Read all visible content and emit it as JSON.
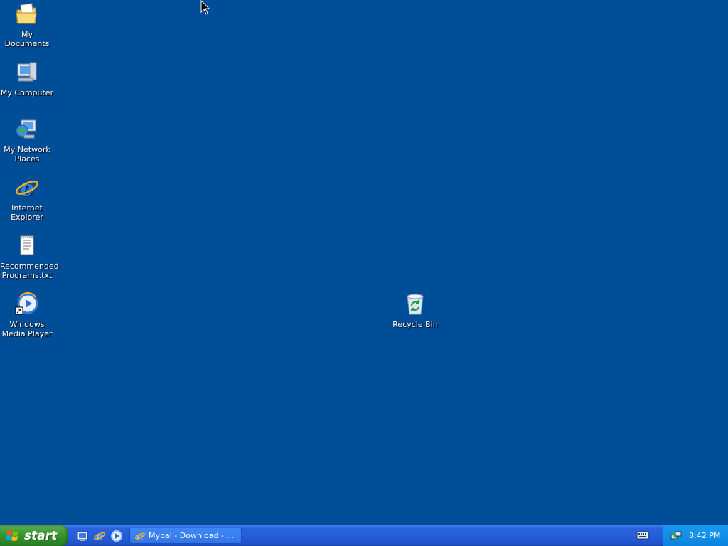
{
  "desktop": {
    "icons": [
      {
        "label": "My Documents",
        "icon": "my-documents-icon"
      },
      {
        "label": "My Computer",
        "icon": "my-computer-icon"
      },
      {
        "label": "My Network Places",
        "icon": "network-places-icon"
      },
      {
        "label": "Internet Explorer",
        "icon": "internet-explorer-icon"
      },
      {
        "label": "Recommended Programs.txt",
        "icon": "text-file-icon"
      },
      {
        "label": "Windows Media Player",
        "icon": "media-player-icon"
      },
      {
        "label": "Recycle Bin",
        "icon": "recycle-bin-icon"
      }
    ],
    "background_color": "#004e98"
  },
  "taskbar": {
    "start_label": "start",
    "quick_launch": [
      "show-desktop-icon",
      "internet-explorer-icon",
      "media-player-icon"
    ],
    "task_button_label": "Mypal - Download - ...",
    "clock": "8:42 PM"
  }
}
